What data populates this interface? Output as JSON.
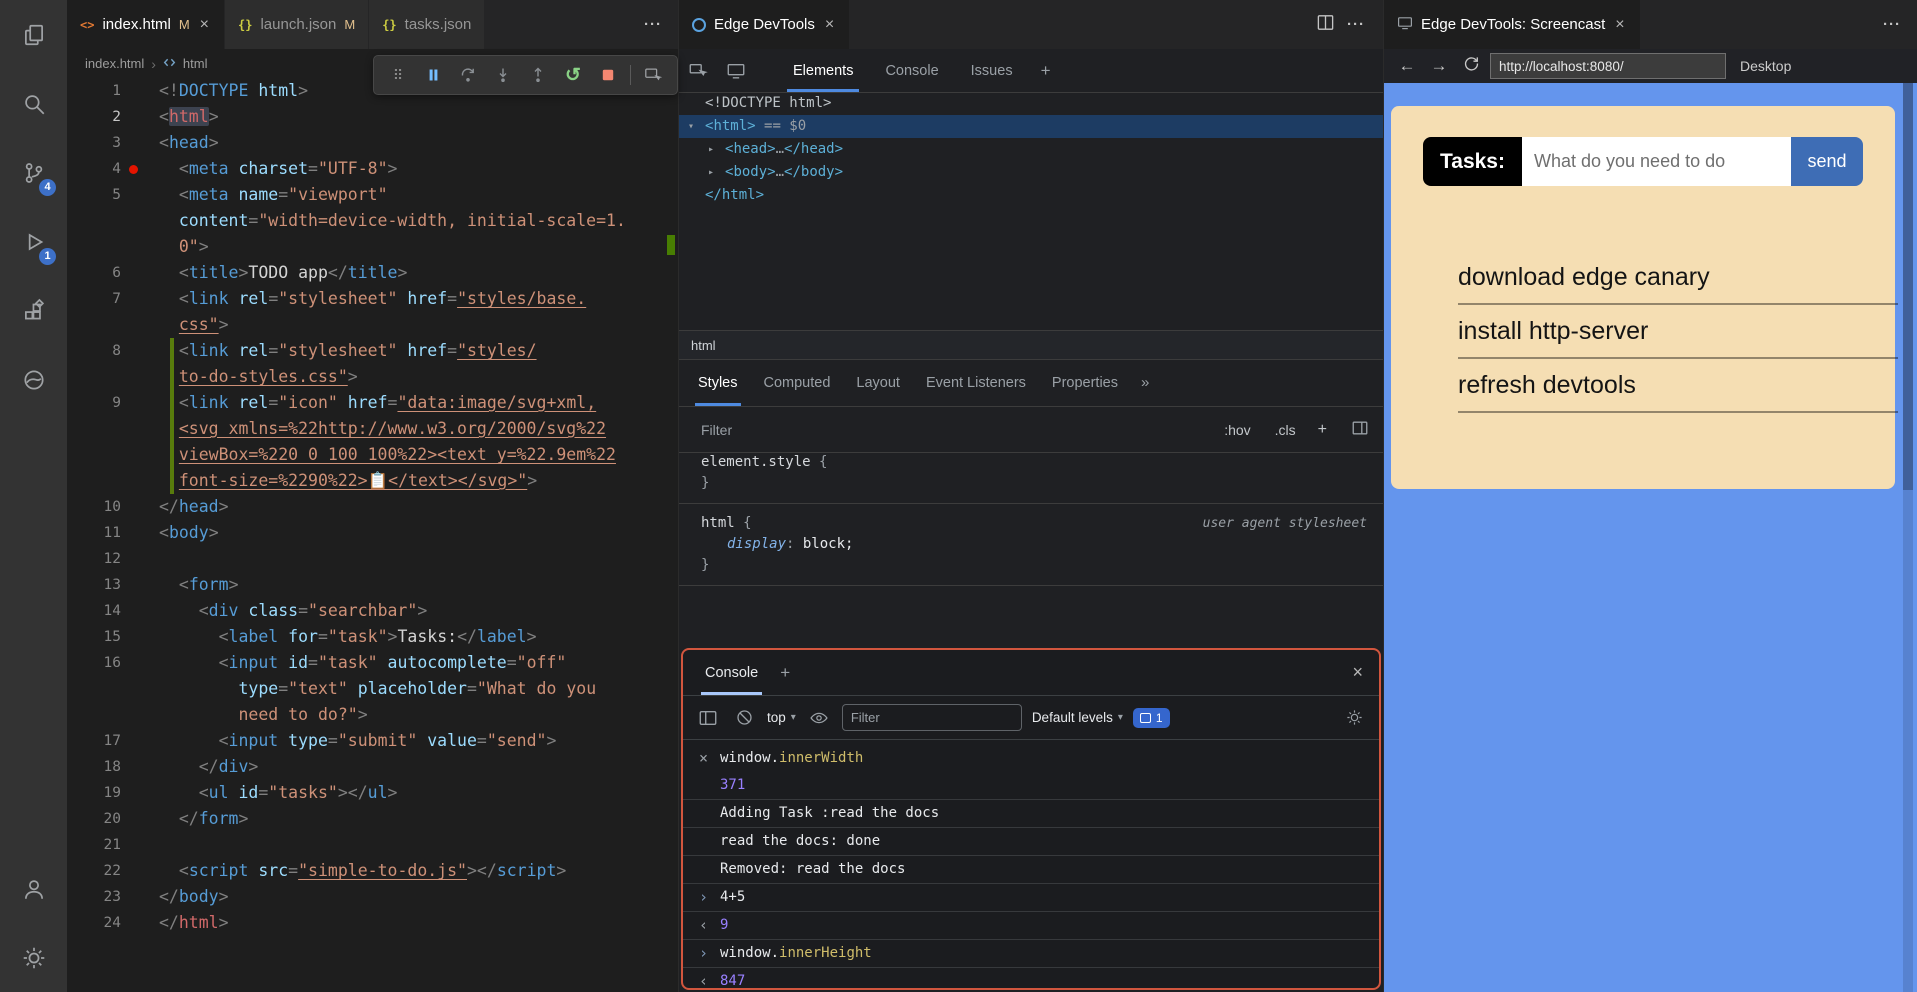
{
  "glyphs": {
    "close": "×",
    "more": "···",
    "plus": "+",
    "caret": "▾",
    "gt": "›",
    "lt": "‹",
    "guillemet": "»",
    "drag": "⠿",
    "restart": "↺",
    "html_icon": "<>",
    "json_icon": "{}"
  },
  "colors": {
    "console_border": "#d2563e",
    "screencast_bg": "#6495ed",
    "card_bg": "#f5deb3",
    "send_bg": "#3e6db5",
    "activity_badge": "#3d70c8",
    "git_added": "#587c0c"
  },
  "activity_bar": {
    "items": [
      "explorer",
      "search",
      "source-control",
      "run-and-debug",
      "extensions",
      "edge-devtools"
    ],
    "badges": {
      "source_control": "4",
      "debug": "1"
    },
    "bottom": [
      "account",
      "settings"
    ]
  },
  "editor_group_left": {
    "tabs": [
      {
        "label": "index.html",
        "badge": "M",
        "icon": "html"
      },
      {
        "label": "launch.json",
        "badge": "M",
        "icon": "json"
      },
      {
        "label": "tasks.json",
        "badge": "",
        "icon": "json"
      }
    ],
    "breadcrumb": {
      "file": "index.html",
      "symbol": "html"
    }
  },
  "debug_toolbar": {
    "buttons": [
      "drag-handle",
      "pause",
      "step-over",
      "step-into",
      "step-out",
      "restart",
      "stop",
      "inspect"
    ]
  },
  "editor": {
    "rows": [
      {
        "n": "1",
        "seg": [
          [
            "pun",
            "<!"
          ],
          [
            "tag",
            "DOCTYPE"
          ],
          [
            "attr",
            " html"
          ],
          [
            "pun",
            ">"
          ]
        ]
      },
      {
        "n": "2",
        "cur": true,
        "seg": [
          [
            "pun",
            "<"
          ],
          [
            "tagm whl",
            "html"
          ],
          [
            "pun",
            ">"
          ]
        ]
      },
      {
        "n": "3",
        "seg": [
          [
            "pun",
            "<"
          ],
          [
            "tag",
            "head"
          ],
          [
            "pun",
            ">"
          ]
        ]
      },
      {
        "n": "4",
        "bp": true,
        "seg": [
          [
            "pun",
            "  <"
          ],
          [
            "tag",
            "meta"
          ],
          [
            "attr",
            " charset"
          ],
          [
            "pun",
            "="
          ],
          [
            "str",
            "\"UTF-8\""
          ],
          [
            "pun",
            ">"
          ]
        ]
      },
      {
        "n": "5",
        "seg": [
          [
            "pun",
            "  <"
          ],
          [
            "tag",
            "meta"
          ],
          [
            "attr",
            " name"
          ],
          [
            "pun",
            "="
          ],
          [
            "str",
            "\"viewport\""
          ]
        ]
      },
      {
        "n": "",
        "seg": [
          [
            "attr",
            "  content"
          ],
          [
            "pun",
            "="
          ],
          [
            "str",
            "\"width=device-width, initial-scale=1."
          ]
        ]
      },
      {
        "n": "",
        "seg": [
          [
            "pln",
            "  "
          ],
          [
            "str",
            "0\""
          ],
          [
            "pun",
            ">"
          ]
        ]
      },
      {
        "n": "6",
        "seg": [
          [
            "pun",
            "  <"
          ],
          [
            "tag",
            "title"
          ],
          [
            "pun",
            ">"
          ],
          [
            "txt",
            "TODO app"
          ],
          [
            "pun",
            "</"
          ],
          [
            "tag",
            "title"
          ],
          [
            "pun",
            ">"
          ]
        ]
      },
      {
        "n": "7",
        "seg": [
          [
            "pun",
            "  <"
          ],
          [
            "tag",
            "link"
          ],
          [
            "attr",
            " rel"
          ],
          [
            "pun",
            "="
          ],
          [
            "str",
            "\"stylesheet\""
          ],
          [
            "attr",
            " href"
          ],
          [
            "pun",
            "="
          ],
          [
            "lnk",
            "\"styles/base."
          ]
        ]
      },
      {
        "n": "",
        "seg": [
          [
            "pln",
            "  "
          ],
          [
            "lnk",
            "css\""
          ],
          [
            "pun",
            ">"
          ]
        ]
      },
      {
        "n": "8",
        "mod": true,
        "seg": [
          [
            "pun",
            "  <"
          ],
          [
            "tag",
            "link"
          ],
          [
            "attr",
            " rel"
          ],
          [
            "pun",
            "="
          ],
          [
            "str",
            "\"stylesheet\""
          ],
          [
            "attr",
            " href"
          ],
          [
            "pun",
            "="
          ],
          [
            "lnk",
            "\"styles/"
          ]
        ]
      },
      {
        "n": "",
        "mod": true,
        "se g": [],
        "seg": [
          [
            "pln",
            "  "
          ],
          [
            "lnk",
            "to-do-styles.css\""
          ],
          [
            "pun",
            ">"
          ]
        ]
      },
      {
        "n": "9",
        "mod": true,
        "seg": [
          [
            "pun",
            "  <"
          ],
          [
            "tag",
            "link"
          ],
          [
            "attr",
            " rel"
          ],
          [
            "pun",
            "="
          ],
          [
            "str",
            "\"icon\""
          ],
          [
            "attr",
            " href"
          ],
          [
            "pun",
            "="
          ],
          [
            "lnk",
            "\"data:image/svg+xml,"
          ]
        ]
      },
      {
        "n": "",
        "mod": true,
        "seg": [
          [
            "pln",
            "  "
          ],
          [
            "lnk",
            "<svg xmlns=%22http://www.w3.org/2000/svg%22"
          ]
        ]
      },
      {
        "n": "",
        "mod": true,
        "seg": [
          [
            "pln",
            "  "
          ],
          [
            "lnk",
            "viewBox=%220 0 100 100%22><text y=%22.9em%22"
          ]
        ]
      },
      {
        "n": "",
        "mod": true,
        "seg": [
          [
            "pln",
            "  "
          ],
          [
            "lnk",
            "font-size=%2290%22>📋</text></svg>\""
          ],
          [
            "pun",
            ">"
          ]
        ]
      },
      {
        "n": "10",
        "seg": [
          [
            "pun",
            "</"
          ],
          [
            "tag",
            "head"
          ],
          [
            "pun",
            ">"
          ]
        ]
      },
      {
        "n": "11",
        "seg": [
          [
            "pun",
            "<"
          ],
          [
            "tag",
            "body"
          ],
          [
            "pun",
            ">"
          ]
        ]
      },
      {
        "n": "12",
        "seg": []
      },
      {
        "n": "13",
        "seg": [
          [
            "pun",
            "  <"
          ],
          [
            "tag",
            "form"
          ],
          [
            "pun",
            ">"
          ]
        ]
      },
      {
        "n": "14",
        "seg": [
          [
            "pun",
            "    <"
          ],
          [
            "tag",
            "div"
          ],
          [
            "attr",
            " class"
          ],
          [
            "pun",
            "="
          ],
          [
            "str",
            "\"searchbar\""
          ],
          [
            "pun",
            ">"
          ]
        ]
      },
      {
        "n": "15",
        "seg": [
          [
            "pun",
            "      <"
          ],
          [
            "tag",
            "label"
          ],
          [
            "attr",
            " for"
          ],
          [
            "pun",
            "="
          ],
          [
            "str",
            "\"task\""
          ],
          [
            "pun",
            ">"
          ],
          [
            "txt",
            "Tasks:"
          ],
          [
            "pun",
            "</"
          ],
          [
            "tag",
            "label"
          ],
          [
            "pun",
            ">"
          ]
        ]
      },
      {
        "n": "16",
        "seg": [
          [
            "pun",
            "      <"
          ],
          [
            "tag",
            "input"
          ],
          [
            "attr",
            " id"
          ],
          [
            "pun",
            "="
          ],
          [
            "str",
            "\"task\""
          ],
          [
            "attr",
            " autocomplete"
          ],
          [
            "pun",
            "="
          ],
          [
            "str",
            "\"off\""
          ]
        ]
      },
      {
        "n": "",
        "seg": [
          [
            "attr",
            "        type"
          ],
          [
            "pun",
            "="
          ],
          [
            "str",
            "\"text\""
          ],
          [
            "attr",
            " placeholder"
          ],
          [
            "pun",
            "="
          ],
          [
            "str",
            "\"What do you"
          ]
        ]
      },
      {
        "n": "",
        "seg": [
          [
            "pln",
            "        "
          ],
          [
            "str",
            "need to do?\""
          ],
          [
            "pun",
            ">"
          ]
        ]
      },
      {
        "n": "17",
        "seg": [
          [
            "pun",
            "      <"
          ],
          [
            "tag",
            "input"
          ],
          [
            "attr",
            " type"
          ],
          [
            "pun",
            "="
          ],
          [
            "str",
            "\"submit\""
          ],
          [
            "attr",
            " value"
          ],
          [
            "pun",
            "="
          ],
          [
            "str",
            "\"send\""
          ],
          [
            "pun",
            ">"
          ]
        ]
      },
      {
        "n": "18",
        "seg": [
          [
            "pun",
            "    </"
          ],
          [
            "tag",
            "div"
          ],
          [
            "pun",
            ">"
          ]
        ]
      },
      {
        "n": "19",
        "seg": [
          [
            "pun",
            "    <"
          ],
          [
            "tag",
            "ul"
          ],
          [
            "attr",
            " id"
          ],
          [
            "pun",
            "="
          ],
          [
            "str",
            "\"tasks\""
          ],
          [
            "pun",
            "></"
          ],
          [
            "tag",
            "ul"
          ],
          [
            "pun",
            ">"
          ]
        ]
      },
      {
        "n": "20",
        "seg": [
          [
            "pun",
            "  </"
          ],
          [
            "tag",
            "form"
          ],
          [
            "pun",
            ">"
          ]
        ]
      },
      {
        "n": "21",
        "seg": []
      },
      {
        "n": "22",
        "seg": [
          [
            "pun",
            "  <"
          ],
          [
            "tag",
            "script"
          ],
          [
            "attr",
            " src"
          ],
          [
            "pun",
            "="
          ],
          [
            "lnk",
            "\"simple-to-do.js\""
          ],
          [
            "pun",
            "></"
          ],
          [
            "tag",
            "script"
          ],
          [
            "pun",
            ">"
          ]
        ]
      },
      {
        "n": "23",
        "seg": [
          [
            "pun",
            "</"
          ],
          [
            "tag",
            "body"
          ],
          [
            "pun",
            ">"
          ]
        ]
      },
      {
        "n": "24",
        "seg": [
          [
            "pun",
            "</"
          ],
          [
            "tagm",
            "html"
          ],
          [
            "pun",
            ">"
          ]
        ]
      }
    ]
  },
  "devtools": {
    "tab_title": "Edge DevTools",
    "tabs": [
      {
        "label": "Elements",
        "active": true
      },
      {
        "label": "Console",
        "active": false
      },
      {
        "label": "Issues",
        "active": false
      }
    ],
    "tree": [
      {
        "seg": [
          [
            "dgray",
            "<!DOCTYPE html>"
          ]
        ]
      },
      {
        "sel": true,
        "arrow": "▾",
        "seg": [
          [
            "dpun",
            "<"
          ],
          [
            "dtag",
            "html"
          ],
          [
            "dpun",
            ">"
          ],
          [
            "dmeta",
            " == $0"
          ]
        ]
      },
      {
        "ind": true,
        "arrow": "▸",
        "seg": [
          [
            "dpun",
            "<"
          ],
          [
            "dtag",
            "head"
          ],
          [
            "dpun",
            ">"
          ],
          [
            "ddots",
            "…"
          ],
          [
            "dpun",
            "</"
          ],
          [
            "dtag",
            "head"
          ],
          [
            "dpun",
            ">"
          ]
        ]
      },
      {
        "ind": true,
        "arrow": "▸",
        "seg": [
          [
            "dpun",
            "<"
          ],
          [
            "dtag",
            "body"
          ],
          [
            "dpun",
            ">"
          ],
          [
            "ddots",
            "…"
          ],
          [
            "dpun",
            "</"
          ],
          [
            "dtag",
            "body"
          ],
          [
            "dpun",
            ">"
          ]
        ]
      },
      {
        "seg": [
          [
            "dpun",
            "</"
          ],
          [
            "dtag",
            "html"
          ],
          [
            "dpun",
            ">"
          ]
        ]
      }
    ],
    "crumb": "html",
    "style_tabs": [
      "Styles",
      "Computed",
      "Layout",
      "Event Listeners",
      "Properties"
    ],
    "filter_placeholder": "Filter",
    "hov": ":hov",
    "cls": ".cls",
    "styles": {
      "el_style": "element.style",
      "open_brace": " {",
      "close_brace": "}",
      "rule_selector": "html",
      "origin": "user agent stylesheet",
      "prop": "display",
      "colon": ": ",
      "value": "block;"
    },
    "console": {
      "tab": "Console",
      "top": "top",
      "filter_placeholder": "Filter",
      "levels": "Default levels",
      "badge": "1",
      "rows": [
        {
          "icon": "close",
          "seg": [
            [
              "cw",
              "window."
            ],
            [
              "cy",
              "innerWidth"
            ]
          ]
        },
        {
          "icon": "",
          "seg": [
            [
              "cp",
              "371"
            ]
          ]
        },
        {
          "sep": true,
          "icon": "",
          "seg": [
            [
              "cw",
              "Adding Task :read the docs"
            ]
          ]
        },
        {
          "sep": true,
          "icon": "",
          "seg": [
            [
              "cw",
              "read the docs: done"
            ]
          ]
        },
        {
          "sep": true,
          "icon": "",
          "seg": [
            [
              "cw",
              "Removed: read the docs"
            ]
          ]
        },
        {
          "sep": true,
          "icon": "in",
          "seg": [
            [
              "cw",
              "4+5"
            ]
          ]
        },
        {
          "sep": true,
          "icon": "out",
          "seg": [
            [
              "cp",
              "9"
            ]
          ]
        },
        {
          "sep": true,
          "icon": "in",
          "seg": [
            [
              "cw",
              "window."
            ],
            [
              "cy",
              "innerHeight"
            ]
          ]
        },
        {
          "sep": true,
          "icon": "out",
          "seg": [
            [
              "cp",
              "847"
            ]
          ]
        }
      ]
    }
  },
  "screencast": {
    "tab_title": "Edge DevTools: Screencast",
    "url": "http://localhost:8080/",
    "device": "Desktop",
    "page": {
      "label": "Tasks:",
      "placeholder": "What do you need to do",
      "send": "send",
      "items": [
        "download edge canary",
        "install http-server",
        "refresh devtools"
      ]
    }
  }
}
